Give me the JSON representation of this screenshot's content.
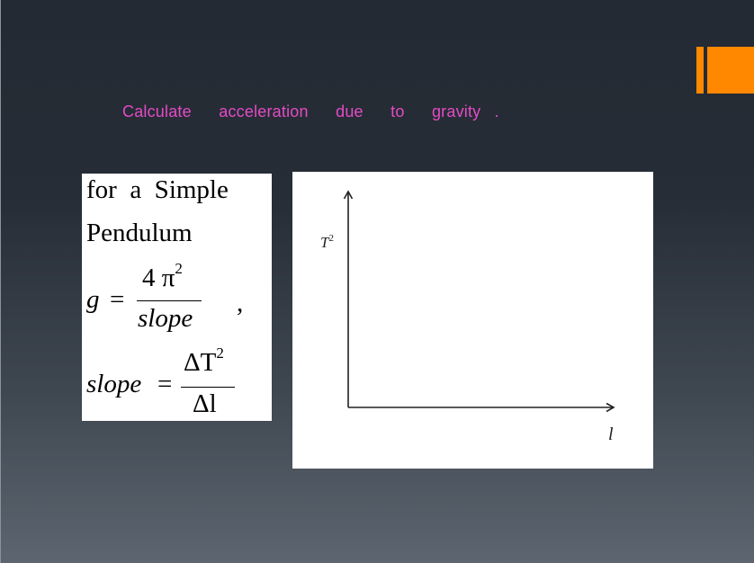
{
  "slide": {
    "title": "Calculate  acceleration  due  to  gravity .",
    "colors": {
      "title": "#e44bc6",
      "accent": "#ff8800",
      "background_top": "#242a33",
      "background_bottom": "#5d6570"
    }
  },
  "formula": {
    "line1": "for  a  Simple",
    "line2": "Pendulum",
    "g_lhs": "g",
    "equals": "=",
    "g_numerator": "4 π",
    "g_numerator_exp": "2",
    "g_denominator": "slope",
    "comma": ",",
    "slope_lhs": "slope",
    "slope_numerator": "ΔT",
    "slope_numerator_exp": "2",
    "slope_denominator": "Δl"
  },
  "graph": {
    "y_label": "T",
    "y_label_exp": "2",
    "x_label": "l"
  }
}
